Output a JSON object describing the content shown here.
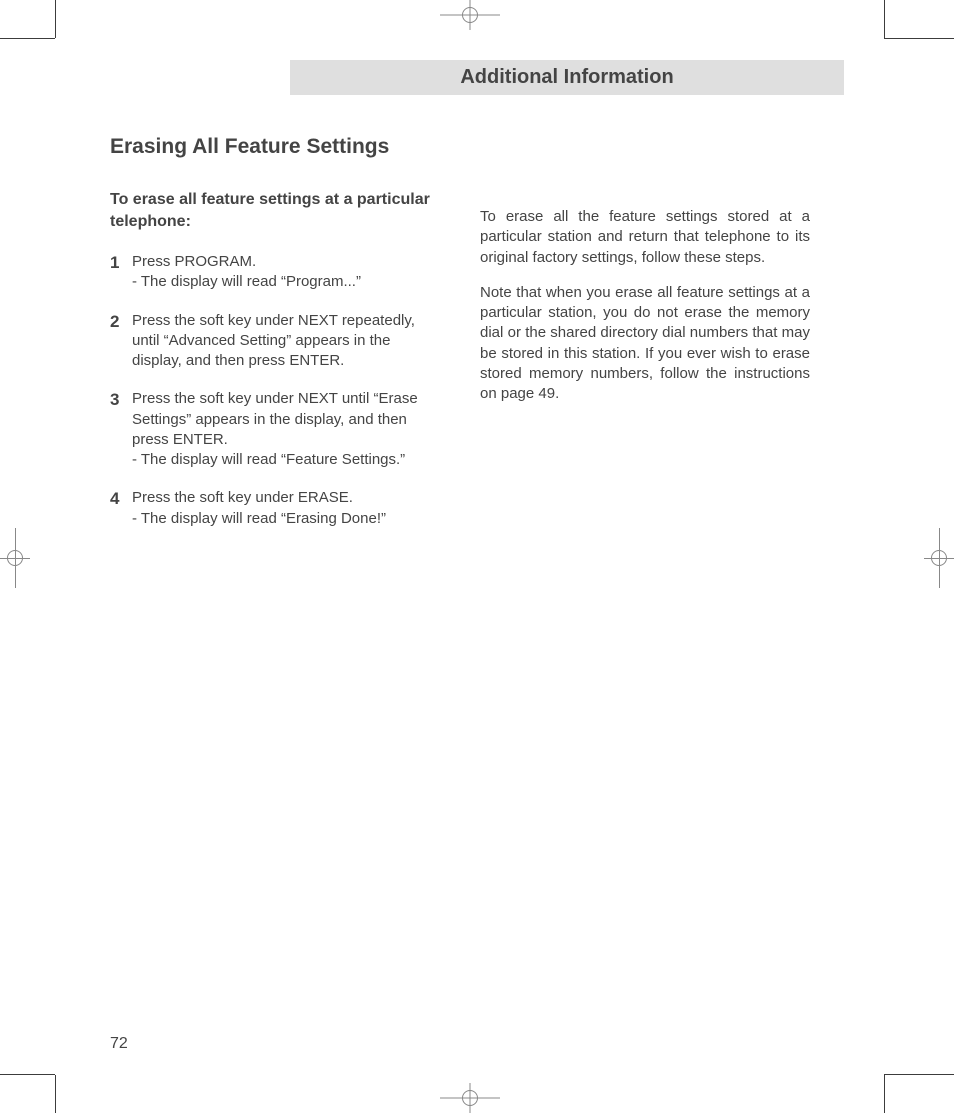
{
  "header": {
    "title": "Additional Information"
  },
  "section_title": "Erasing All Feature Settings",
  "left": {
    "subhead": "To erase all feature settings at a particular telephone:",
    "steps": [
      {
        "num": "1",
        "body": "Press PROGRAM.\n- The display will read “Program...”"
      },
      {
        "num": "2",
        "body": "Press the soft key under NEXT repeatedly, until “Advanced Setting” appears in the display, and then press ENTER."
      },
      {
        "num": "3",
        "body": "Press the soft key under NEXT until “Erase Settings” appears in the display, and then press ENTER.\n- The display will read “Feature Settings.”"
      },
      {
        "num": "4",
        "body": "Press the soft key under ERASE.\n- The display will read “Erasing Done!”"
      }
    ]
  },
  "right": {
    "p1": "To erase all the feature settings stored at a particular station and return that telephone to its original factory settings, follow these steps.",
    "p2": "Note that when you erase all feature settings at a particular station, you do not erase the memory dial or the shared directory dial numbers that may be stored in this station.  If you ever wish to erase stored memory numbers, follow the instructions on page 49."
  },
  "page_number": "72"
}
